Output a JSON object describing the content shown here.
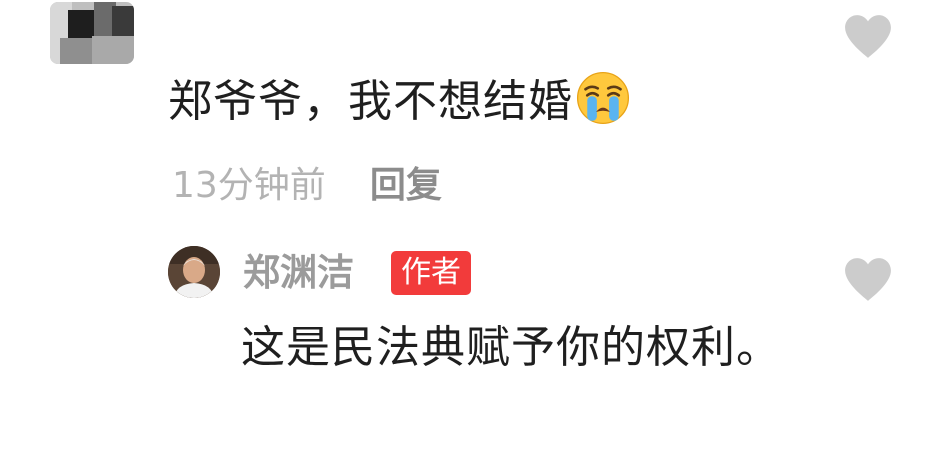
{
  "comment": {
    "username": "",
    "text": "郑爷爷，我不想结婚",
    "emoji": "loudly-crying-face-emoji",
    "time": "13分钟前",
    "reply_label": "回复"
  },
  "reply": {
    "author_name": "郑渊洁",
    "author_badge": "作者",
    "text": "这是民法典赋予你的权利。"
  },
  "icons": {
    "like": "heart-icon",
    "emoji": "loudly-crying-face-emoji"
  },
  "colors": {
    "primary_text": "#1f1f1f",
    "secondary_text": "#b3b3b3",
    "reply_link": "#8c8c8c",
    "author_name": "#9b9b9b",
    "badge_bg": "#f23b3b",
    "heart": "#cccccc"
  }
}
